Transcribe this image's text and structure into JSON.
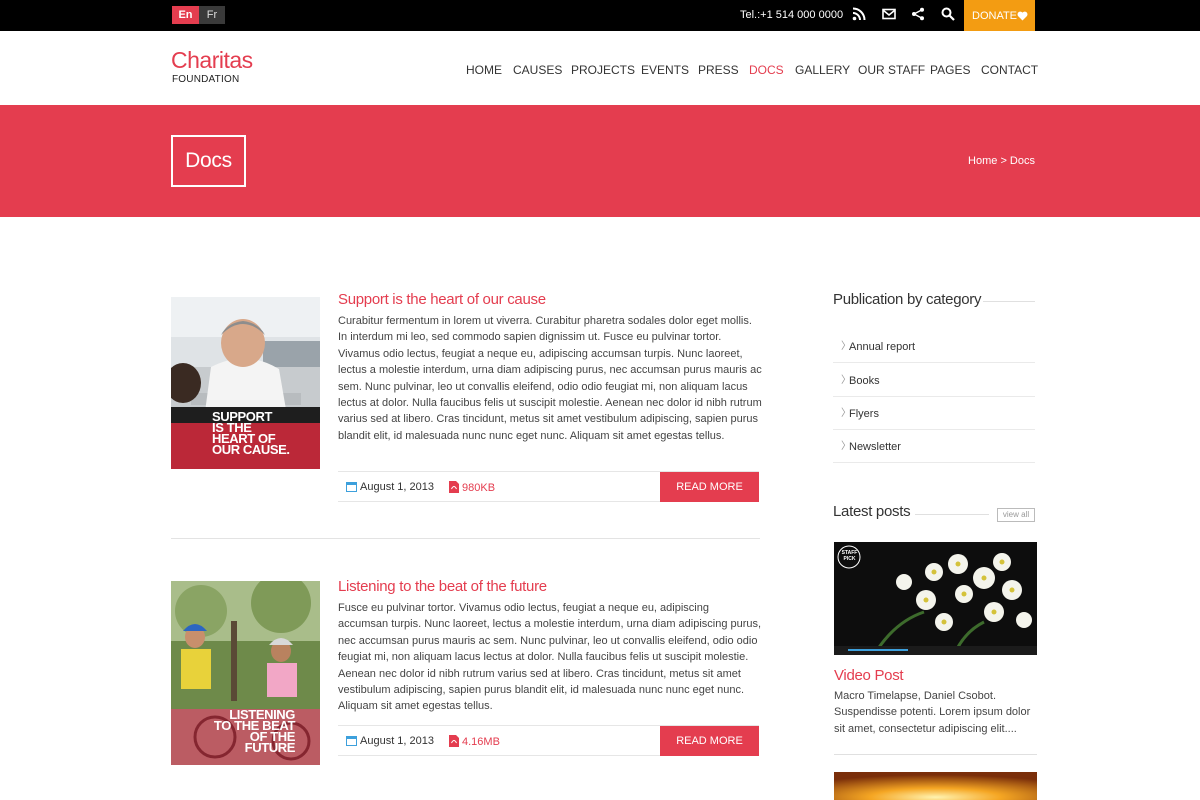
{
  "topbar": {
    "lang_en": "En",
    "lang_fr": "Fr",
    "tel": "Tel.:+1 514 000 0000",
    "icons": [
      "rss-icon",
      "mail-icon",
      "share-icon",
      "search-icon"
    ],
    "donate": "DONATE"
  },
  "header": {
    "logo_title": "Charitas",
    "logo_sub": "FOUNDATION",
    "nav": [
      "HOME",
      "CAUSES",
      "PROJECTS",
      "EVENTS",
      "PRESS",
      "DOCS",
      "GALLERY",
      "OUR STAFF",
      "PAGES",
      "CONTACT"
    ],
    "active": "DOCS"
  },
  "banner": {
    "title": "Docs",
    "breadcrumb": "Home > Docs"
  },
  "posts": [
    {
      "title": "Support is the heart of our cause",
      "body": "Curabitur fermentum in lorem ut viverra. Curabitur pharetra sodales dolor eget mollis. In interdum mi leo, sed commodo sapien dignissim ut. Fusce eu pulvinar tortor. Vivamus odio lectus, feugiat a neque eu, adipiscing accumsan turpis. Nunc laoreet, lectus a molestie interdum, urna diam adipiscing purus, nec accumsan purus mauris ac sem. Nunc pulvinar, leo ut convallis eleifend, odio odio feugiat mi, non aliquam lacus lectus at dolor. Nulla faucibus felis ut suscipit molestie. Aenean nec dolor id nibh rutrum varius sed at libero. Cras tincidunt, metus sit amet vestibulum adipiscing, sapien purus blandit elit, id malesuada nunc nunc eget nunc. Aliquam sit amet egestas tellus.",
      "date": "August 1, 2013",
      "size": "980KB",
      "read_more": "READ MORE",
      "thumb_caption": [
        "SUPPORT",
        "IS THE",
        "HEART OF",
        "OUR CAUSE."
      ]
    },
    {
      "title": "Listening to the beat of the future",
      "body": "Fusce eu pulvinar tortor. Vivamus odio lectus, feugiat a neque eu, adipiscing accumsan turpis. Nunc laoreet, lectus a molestie interdum, urna diam adipiscing purus, nec accumsan purus mauris ac sem. Nunc pulvinar, leo ut convallis eleifend, odio odio feugiat mi, non aliquam lacus lectus at dolor. Nulla faucibus felis ut suscipit molestie. Aenean nec dolor id nibh rutrum varius sed at libero. Cras tincidunt, metus sit amet vestibulum adipiscing, sapien purus blandit elit, id malesuada nunc nunc eget nunc. Aliquam sit amet egestas tellus.",
      "date": "August 1, 2013",
      "size": "4.16MB",
      "read_more": "READ MORE",
      "thumb_caption": [
        "LISTENING",
        "TO THE BEAT",
        "OF THE",
        "FUTURE"
      ]
    }
  ],
  "sidebar": {
    "category_heading": "Publication by category",
    "categories": [
      "Annual report",
      "Books",
      "Flyers",
      "Newsletter"
    ],
    "latest_heading": "Latest posts",
    "view_all": "view all",
    "latest_post": {
      "title": "Video Post",
      "body": "Macro Timelapse, Daniel Csobot. Suspendisse potenti. Lorem ipsum dolor sit amet, consectetur adipiscing elit....",
      "badge": [
        "STAFF",
        "PICK"
      ]
    }
  },
  "colors": {
    "accent": "#e43d4f",
    "donate": "#f39c12",
    "topbar": "#000000"
  }
}
